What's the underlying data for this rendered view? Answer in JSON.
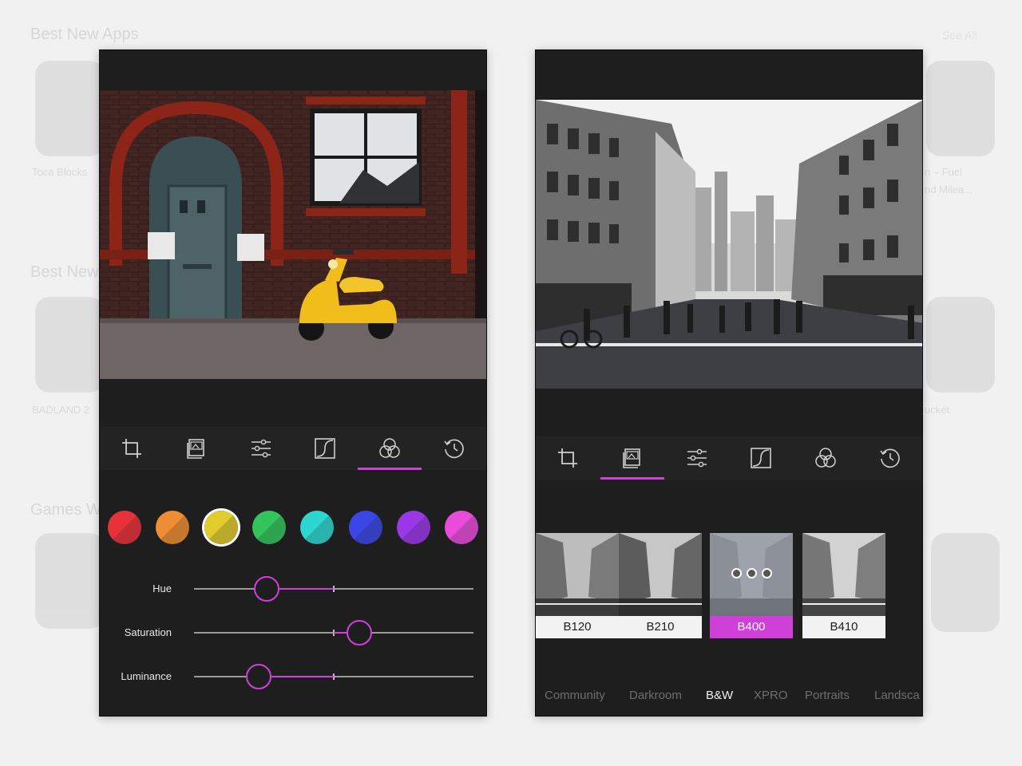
{
  "background": {
    "headings": [
      "Best New Apps",
      "Best New",
      "Games W"
    ],
    "see_all": "See All",
    "captions": [
      "Toca Blocks",
      "BADLAND 2",
      "ucket",
      "n – Fuel",
      "nd Milea..."
    ]
  },
  "left_panel": {
    "toolbar": {
      "active_index": 4,
      "icons": [
        "crop-icon",
        "presets-icon",
        "adjust-icon",
        "curves-icon",
        "color-mix-icon",
        "history-icon"
      ]
    },
    "swatches": [
      {
        "name": "red",
        "color": "#e8323a"
      },
      {
        "name": "orange",
        "color": "#ef8d34"
      },
      {
        "name": "yellow",
        "color": "#e1cc2e",
        "selected": true
      },
      {
        "name": "green",
        "color": "#33c45c"
      },
      {
        "name": "cyan",
        "color": "#2ed6d2"
      },
      {
        "name": "blue",
        "color": "#3a46e6"
      },
      {
        "name": "purple",
        "color": "#9a38e8"
      },
      {
        "name": "magenta",
        "color": "#e84cd9"
      }
    ],
    "sliders": [
      {
        "label": "Hue",
        "value": -0.48
      },
      {
        "label": "Saturation",
        "value": 0.18
      },
      {
        "label": "Luminance",
        "value": -0.54
      }
    ]
  },
  "right_panel": {
    "toolbar": {
      "active_index": 1,
      "icons": [
        "crop-icon",
        "presets-icon",
        "adjust-icon",
        "curves-icon",
        "color-mix-icon",
        "history-icon"
      ]
    },
    "filters": [
      {
        "label": "B120",
        "active": false
      },
      {
        "label": "B210",
        "active": false
      },
      {
        "label": "B400",
        "active": true
      },
      {
        "label": "B410",
        "active": false
      }
    ],
    "categories": [
      {
        "label": "Community",
        "active": false
      },
      {
        "label": "Darkroom",
        "active": false
      },
      {
        "label": "B&W",
        "active": true
      },
      {
        "label": "XPRO",
        "active": false
      },
      {
        "label": "Portraits",
        "active": false
      },
      {
        "label": "Landsca",
        "active": false
      }
    ]
  },
  "colors": {
    "accent": "#d040d8",
    "panel_bg": "#1e1e1f",
    "toolbar_bg": "#232324"
  }
}
